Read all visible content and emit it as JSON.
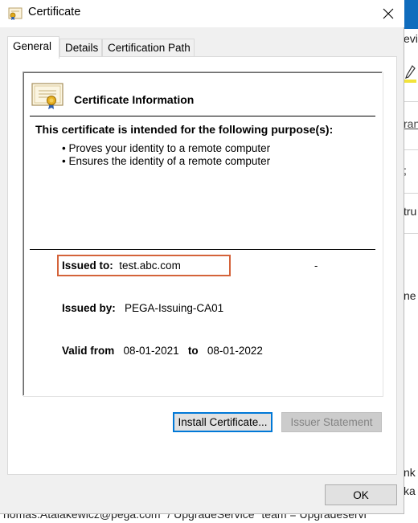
{
  "dialog": {
    "title": "Certificate",
    "tabs": [
      {
        "label": "General"
      },
      {
        "label": "Details"
      },
      {
        "label": "Certification Path"
      }
    ],
    "info_title": "Certificate Information",
    "purpose_heading": "This certificate is intended for the following purpose(s):",
    "purposes": [
      "• Proves your identity to a remote computer",
      "• Ensures the identity of a remote computer"
    ],
    "issued_to_label": "Issued to:",
    "issued_to_value": "test.abc.com",
    "dash": "-",
    "issued_by_label": "Issued by:",
    "issued_by_value": "PEGA-Issuing-CA01",
    "valid_from_label": "Valid from",
    "valid_from_value": "08-01-2021",
    "valid_to_label": "to",
    "valid_to_value": "08-01-2022",
    "install_button": "Install Certificate...",
    "issuer_statement_button": "Issuer Statement",
    "ok_button": "OK"
  },
  "background": {
    "snippets": [
      "evi",
      "ran",
      "; ",
      "tru",
      "ne",
      "nk",
      "ka"
    ],
    "bottom_text": "nomas.Atalakewicz@pega.com\" / UpgradeService\" team = Upgradeservi"
  },
  "colors": {
    "highlight_border": "#d4633a",
    "default_button_border": "#0078d7",
    "background_topbar": "#0f6cbd"
  }
}
